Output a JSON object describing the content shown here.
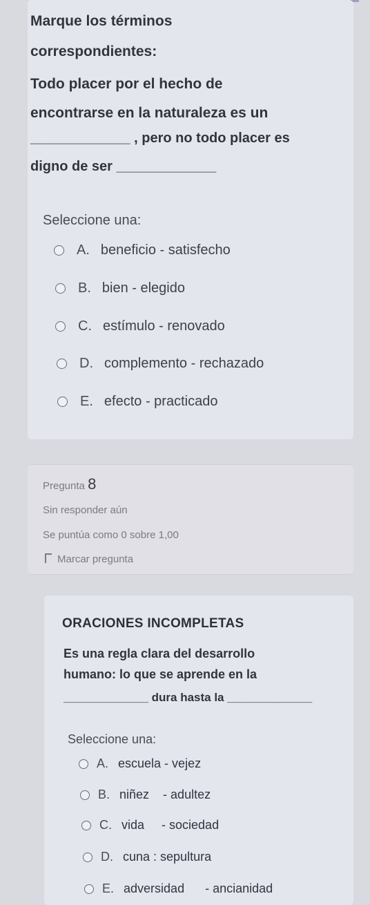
{
  "question1": {
    "lines": [
      "Marque los términos",
      "correspondientes:",
      "Todo placer por el hecho de",
      "encontrarse en la naturaleza es un",
      "_____________ , pero no todo placer es",
      "digno de ser _____________"
    ],
    "prompt": "Seleccione una:",
    "options": [
      {
        "letter": "A.",
        "text": "beneficio - satisfecho"
      },
      {
        "letter": "B.",
        "text": "bien - elegido"
      },
      {
        "letter": "C.",
        "text": "estímulo - renovado"
      },
      {
        "letter": "D.",
        "text": "complemento - rechazado"
      },
      {
        "letter": "E.",
        "text": "efecto - practicado"
      }
    ]
  },
  "question_info": {
    "label": "Pregunta",
    "number": "8",
    "status": "Sin responder aún",
    "score": "Se puntúa como 0 sobre 1,00",
    "flag_label": "Marcar pregunta"
  },
  "question2": {
    "title": "ORACIONES INCOMPLETAS",
    "lines": [
      "Es una regla clara del desarrollo",
      "humano: lo que se aprende en la",
      "_____________ dura hasta la _____________"
    ],
    "prompt": "Seleccione una:",
    "options": [
      {
        "letter": "A.",
        "text": "escuela - vejez"
      },
      {
        "letter": "B.",
        "text": "niñez    - adultez"
      },
      {
        "letter": "C.",
        "text": "vida     - sociedad"
      },
      {
        "letter": "D.",
        "text": "cuna : sepultura"
      },
      {
        "letter": "E.",
        "text": "adversidad      - ancianidad"
      }
    ]
  }
}
